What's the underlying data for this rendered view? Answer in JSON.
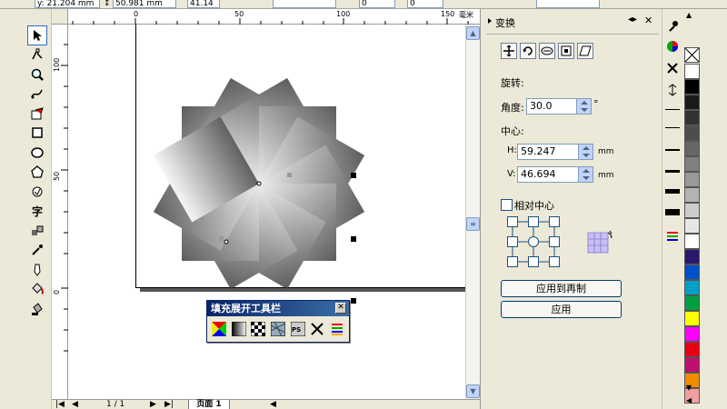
{
  "propbar": {
    "y_field": "y: 21.204 mm",
    "height_field": "50.981 mm",
    "scale_field": "41.14",
    "angle_a": "0",
    "angle_b": "0"
  },
  "ruler": {
    "h_labels": [
      "0",
      "50",
      "100",
      "150"
    ],
    "h_unit": "毫米",
    "v_labels": [
      "100",
      "50",
      "0"
    ]
  },
  "page_nav": {
    "counter": "1 / 1",
    "page_tab": "页面 1"
  },
  "fill_toolbar": {
    "title": "填充展开工具栏"
  },
  "docker": {
    "title": "变换",
    "rotate_label": "旋转:",
    "angle_label": "角度:",
    "angle_value": "30.0",
    "angle_unit": "°",
    "center_label": "中心:",
    "h_label": "H:",
    "h_value": "59.247",
    "v_label": "V:",
    "v_value": "46.694",
    "unit": "mm",
    "relative_center_label": "相对中心",
    "relative_center_checked": false,
    "apply_copy_label": "应用到再制",
    "apply_label": "应用"
  },
  "palette": {
    "colors": [
      "#ffffff",
      "#000000",
      "#1a1a1a",
      "#333333",
      "#4d4d4d",
      "#666666",
      "#808080",
      "#999999",
      "#b3b3b3",
      "#cccccc",
      "#e6e6e6",
      "#ffffff",
      "#2a1a6e",
      "#0050c8",
      "#00a0c8",
      "#00a040",
      "#ffff00",
      "#ff00ff",
      "#e60012",
      "#c0106e",
      "#f08c00",
      "#f0a0a0"
    ]
  }
}
